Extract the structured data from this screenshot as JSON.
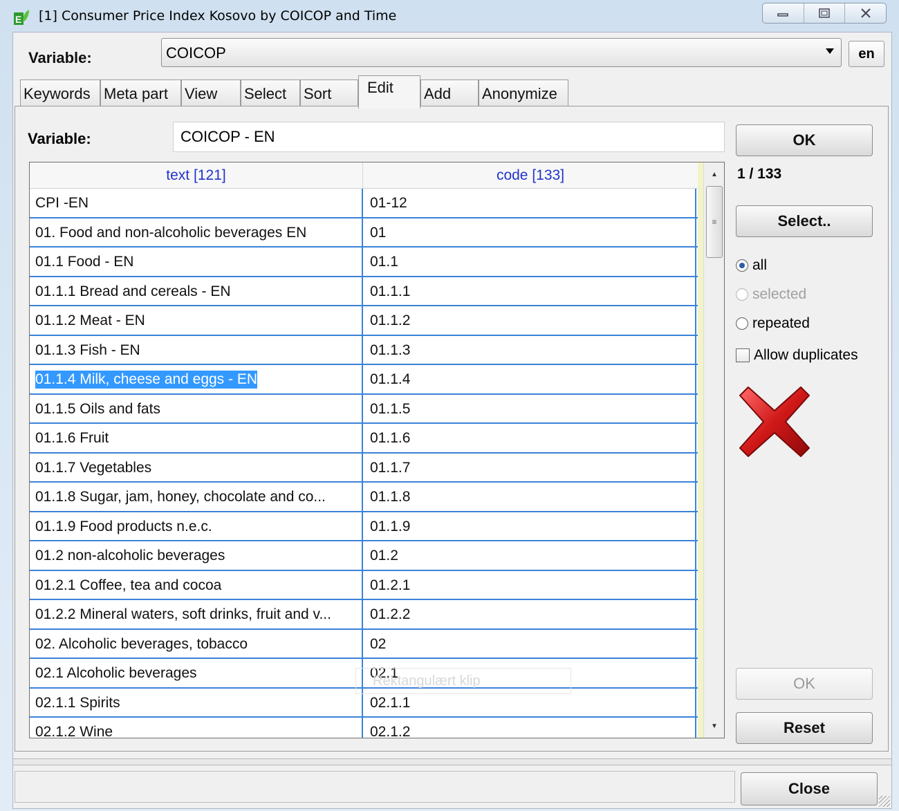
{
  "window": {
    "title": "[1]  Consumer Price Index Kosovo by COICOP and Time",
    "app_icon": "e-leaf-icon",
    "controls": [
      "minimize-icon",
      "maximize-icon",
      "close-icon"
    ]
  },
  "top_bar": {
    "variable_label": "Variable:",
    "variable_value": "COICOP",
    "language_button": "en"
  },
  "tabs": [
    {
      "label": "Keywords"
    },
    {
      "label": "Meta part"
    },
    {
      "label": "View"
    },
    {
      "label": "Select"
    },
    {
      "label": "Sort"
    },
    {
      "label": "Edit",
      "active": true
    },
    {
      "label": "Add"
    },
    {
      "label": "Anonymize"
    }
  ],
  "edit_panel": {
    "variable_label": "Variable:",
    "variable_value": "COICOP - EN",
    "table": {
      "columns": [
        "text  [121]",
        "code  [133]"
      ],
      "rows": [
        [
          "CPI -EN",
          "01-12"
        ],
        [
          "01. Food and non-alcoholic beverages EN",
          "01"
        ],
        [
          "01.1 Food - EN",
          "01.1"
        ],
        [
          "01.1.1 Bread and cereals - EN",
          "01.1.1"
        ],
        [
          "01.1.2 Meat - EN",
          "01.1.2"
        ],
        [
          "01.1.3 Fish - EN",
          "01.1.3"
        ],
        [
          "01.1.4 Milk, cheese and eggs - EN",
          "01.1.4"
        ],
        [
          "01.1.5 Oils and fats",
          "01.1.5"
        ],
        [
          "01.1.6 Fruit",
          "01.1.6"
        ],
        [
          "01.1.7 Vegetables",
          "01.1.7"
        ],
        [
          "01.1.8 Sugar, jam, honey, chocolate and co...",
          "01.1.8"
        ],
        [
          "01.1.9 Food products n.e.c.",
          "01.1.9"
        ],
        [
          "01.2 non-alcoholic beverages",
          "01.2"
        ],
        [
          "01.2.1 Coffee, tea and cocoa",
          "01.2.1"
        ],
        [
          "01.2.2 Mineral waters, soft drinks, fruit and v...",
          "01.2.2"
        ],
        [
          "02. Alcoholic beverages, tobacco",
          "02"
        ],
        [
          "02.1 Alcoholic beverages",
          "02.1"
        ],
        [
          "02.1.1 Spirits",
          "02.1.1"
        ],
        [
          "02.1.2 Wine",
          "02.1.2"
        ]
      ],
      "selected_row": 6
    },
    "ghost_tooltip": "Rektangulært klip",
    "ok_button": "OK",
    "counter": "1 / 133",
    "select_button": "Select..",
    "filter": {
      "all": "all",
      "selected": "selected",
      "repeated": "repeated",
      "checked": "all"
    },
    "allow_duplicates": "Allow duplicates",
    "delete_icon": "red-x-icon",
    "ok_disabled_button": "OK",
    "reset_button": "Reset"
  },
  "footer": {
    "close_button": "Close"
  },
  "colors": {
    "grid_line": "#3a82d8",
    "header_text": "#2233cc",
    "selection": "#3399ff",
    "delete_red": "#d01818"
  }
}
